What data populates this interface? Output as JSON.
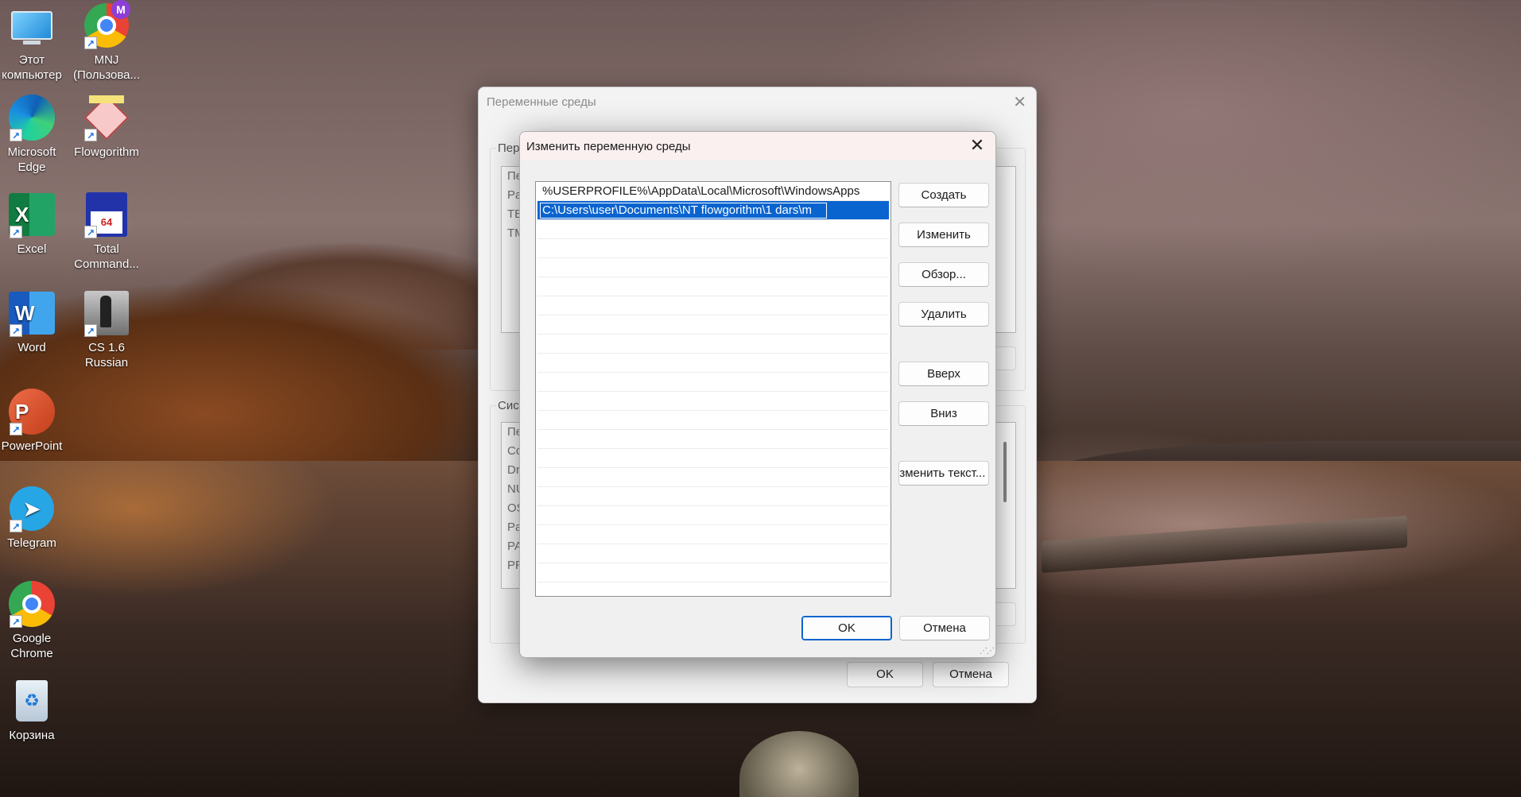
{
  "desktop": {
    "icons": [
      {
        "label": "Этот компьютер",
        "icon": "this-pc-icon"
      },
      {
        "label": "MNJ (Пользова...",
        "icon": "chrome-profile-icon",
        "badge": "M"
      },
      {
        "label": "Microsoft Edge",
        "icon": "edge-icon"
      },
      {
        "label": "Flowgorithm",
        "icon": "flowgorithm-icon"
      },
      {
        "label": "Excel",
        "icon": "excel-icon",
        "glyph": "X"
      },
      {
        "label": "Total Command...",
        "icon": "total-commander-icon",
        "glyph": "64"
      },
      {
        "label": "Word",
        "icon": "word-icon",
        "glyph": "W"
      },
      {
        "label": "CS 1.6 Russian",
        "icon": "cs16-icon"
      },
      {
        "label": "PowerPoint",
        "icon": "powerpoint-icon",
        "glyph": "P"
      },
      {
        "label": "Telegram",
        "icon": "telegram-icon"
      },
      {
        "label": "Google Chrome",
        "icon": "chrome-icon"
      },
      {
        "label": "Корзина",
        "icon": "recycle-bin-icon"
      }
    ]
  },
  "env_dialog": {
    "title": "Переменные среды",
    "user_group_label": "Пер",
    "user_vars_partial": [
      "Пе",
      "Pa",
      "TE",
      "TM"
    ],
    "system_group_label": "Сист",
    "system_vars_partial": [
      "Пе",
      "Co",
      "Dr",
      "NU",
      "OS",
      "Pa",
      "PA",
      "PR"
    ],
    "ok_label": "OK",
    "cancel_label": "Отмена"
  },
  "edit_dialog": {
    "title": "Изменить переменную среды",
    "paths": [
      "%USERPROFILE%\\AppData\\Local\\Microsoft\\WindowsApps",
      "C:\\Users\\user\\Documents\\NT flowgorithm\\1 dars\\m"
    ],
    "selected_index": 1,
    "empty_rows": 19,
    "buttons": {
      "create": "Создать",
      "edit": "Изменить",
      "browse": "Обзор...",
      "delete": "Удалить",
      "up": "Вверх",
      "down": "Вниз",
      "edit_text": "Изменить текст...",
      "ok": "OK",
      "cancel": "Отмена"
    }
  },
  "colors": {
    "selection": "#0a64d0",
    "dialog_bg": "#f0f0f0",
    "titlebar_tint": "#fbf0f0"
  }
}
